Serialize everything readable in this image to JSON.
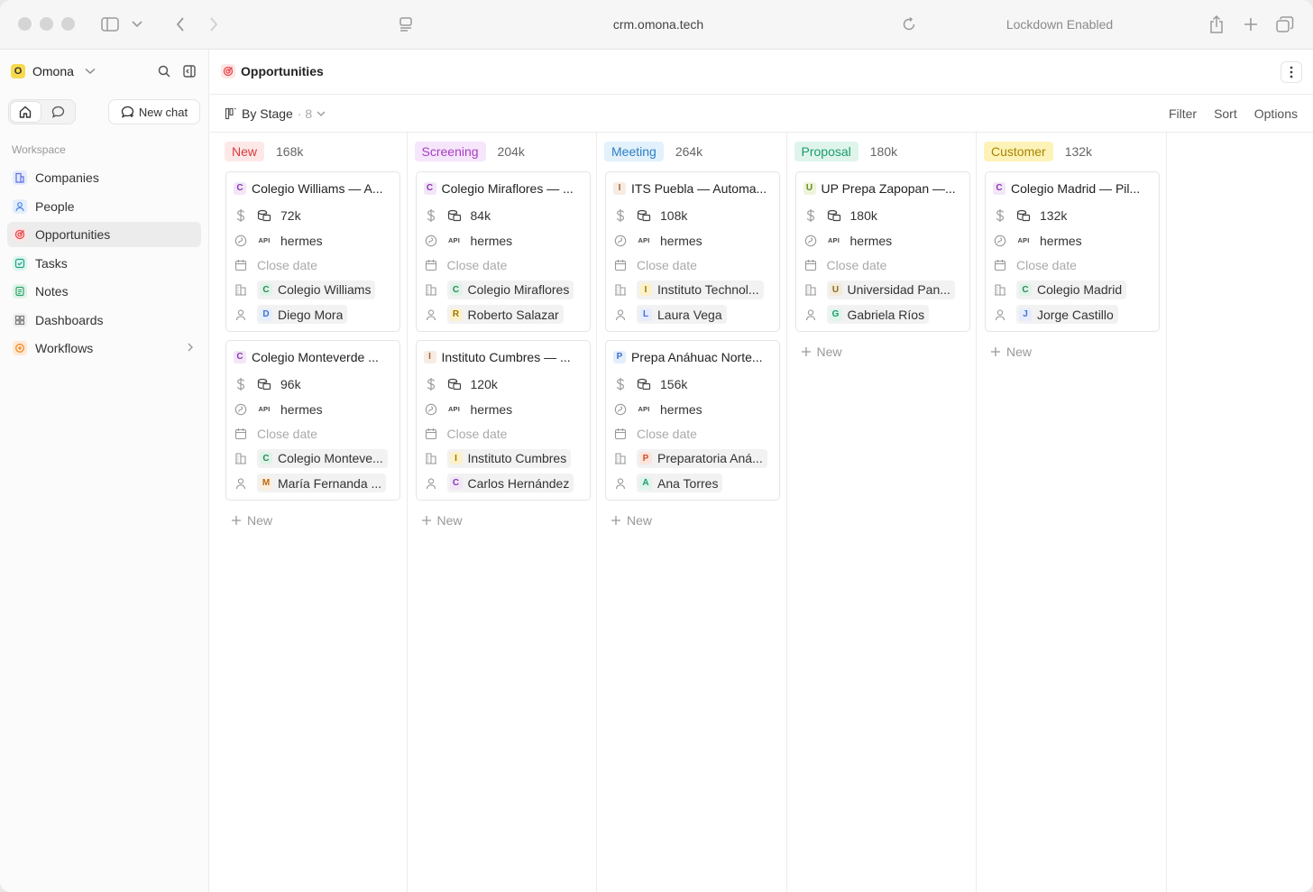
{
  "browser": {
    "url": "crm.omona.tech",
    "lockdown": "Lockdown Enabled"
  },
  "sidebar": {
    "workspace_name": "Omona",
    "workspace_initial": "O",
    "new_chat_label": "New chat",
    "section_label": "Workspace",
    "items": [
      {
        "label": "Companies",
        "color": "#6b7de8"
      },
      {
        "label": "People",
        "color": "#5a8fe8"
      },
      {
        "label": "Opportunities",
        "color": "#e5484d"
      },
      {
        "label": "Tasks",
        "color": "#2bb39a"
      },
      {
        "label": "Notes",
        "color": "#30a46c"
      },
      {
        "label": "Dashboards",
        "color": "#888888"
      },
      {
        "label": "Workflows",
        "color": "#f08a24"
      }
    ]
  },
  "header": {
    "title": "Opportunities"
  },
  "view": {
    "label": "By Stage",
    "count": "· 8",
    "filter": "Filter",
    "sort": "Sort",
    "options": "Options"
  },
  "board": {
    "new_label": "New",
    "close_date_placeholder": "Close date",
    "columns": [
      {
        "stage": "New",
        "amount": "168k",
        "pill_bg": "#fde8e8",
        "pill_fg": "#d93b3b",
        "cards": [
          {
            "initial": "C",
            "title": "Colegio Williams — A...",
            "amount": "72k",
            "owner": "hermes",
            "company_initial": "C",
            "company": "Colegio Williams",
            "person_initial": "D",
            "person": "Diego Mora"
          },
          {
            "initial": "C",
            "title": "Colegio Monteverde ...",
            "amount": "96k",
            "owner": "hermes",
            "company_initial": "C",
            "company": "Colegio Monteve...",
            "person_initial": "M",
            "person": "María Fernanda ..."
          }
        ]
      },
      {
        "stage": "Screening",
        "amount": "204k",
        "pill_bg": "#f6e6fb",
        "pill_fg": "#a83cc4",
        "cards": [
          {
            "initial": "C",
            "title": "Colegio Miraflores — ...",
            "amount": "84k",
            "owner": "hermes",
            "company_initial": "C",
            "company": "Colegio Miraflores",
            "person_initial": "R",
            "person": "Roberto Salazar"
          },
          {
            "initial": "I",
            "title": "Instituto Cumbres — ...",
            "amount": "120k",
            "owner": "hermes",
            "company_initial": "I",
            "company": "Instituto Cumbres",
            "person_initial": "C",
            "person": "Carlos Hernández"
          }
        ]
      },
      {
        "stage": "Meeting",
        "amount": "264k",
        "pill_bg": "#e2f1fc",
        "pill_fg": "#2b7fc4",
        "cards": [
          {
            "initial": "I",
            "title": "ITS Puebla — Automa...",
            "amount": "108k",
            "owner": "hermes",
            "company_initial": "I",
            "company": "Instituto Technol...",
            "person_initial": "L",
            "person": "Laura Vega"
          },
          {
            "initial": "P",
            "title": "Prepa Anáhuac Norte...",
            "amount": "156k",
            "owner": "hermes",
            "company_initial": "P",
            "company": "Preparatoria Aná...",
            "person_initial": "A",
            "person": "Ana Torres"
          }
        ]
      },
      {
        "stage": "Proposal",
        "amount": "180k",
        "pill_bg": "#dff5ec",
        "pill_fg": "#1c9b6c",
        "cards": [
          {
            "initial": "U",
            "title": "UP Prepa Zapopan —...",
            "amount": "180k",
            "owner": "hermes",
            "company_initial": "U",
            "company": "Universidad Pan...",
            "person_initial": "G",
            "person": "Gabriela Ríos"
          }
        ]
      },
      {
        "stage": "Customer",
        "amount": "132k",
        "pill_bg": "#fdf3b8",
        "pill_fg": "#a88400",
        "cards": [
          {
            "initial": "C",
            "title": "Colegio Madrid — Pil...",
            "amount": "132k",
            "owner": "hermes",
            "company_initial": "C",
            "company": "Colegio Madrid",
            "person_initial": "J",
            "person": "Jorge Castillo"
          }
        ]
      }
    ]
  }
}
